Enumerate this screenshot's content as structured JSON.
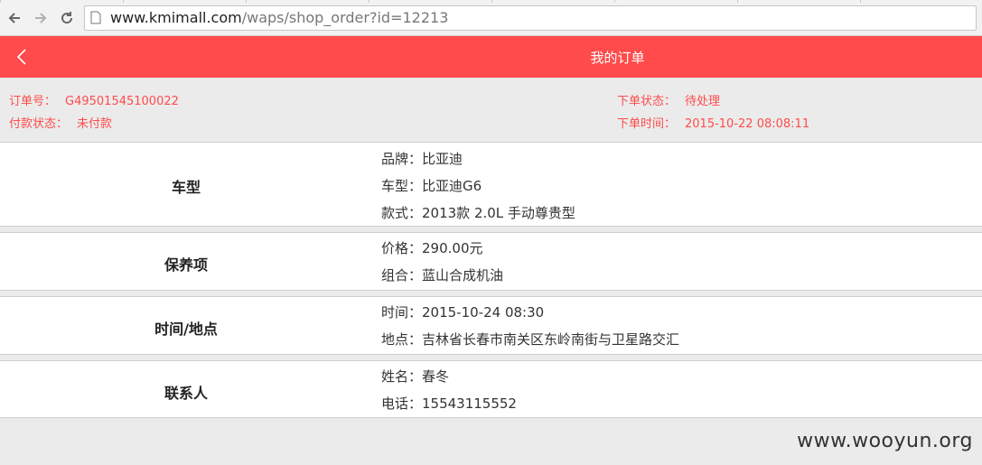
{
  "browser": {
    "url_host": "www.kmimall.com",
    "url_path": "/waps/shop_order?id=12213"
  },
  "header": {
    "title": "我的订单"
  },
  "order": {
    "number_label": "订单号：",
    "number_value": "G49501545100022",
    "pay_status_label": "付款状态：",
    "pay_status_value": "未付款",
    "order_status_label": "下单状态：",
    "order_status_value": "待处理",
    "order_time_label": "下单时间：",
    "order_time_value": "2015-10-22 08:08:11"
  },
  "sections": [
    {
      "label": "车型",
      "lines": [
        "品牌：比亚迪",
        "车型：比亚迪G6",
        "款式：2013款 2.0L 手动尊贵型"
      ]
    },
    {
      "label": "保养项",
      "lines": [
        "价格：290.00元",
        "组合：蓝山合成机油"
      ]
    },
    {
      "label": "时间/地点",
      "lines": [
        "时间：2015-10-24 08:30",
        "地点：吉林省长春市南关区东岭南街与卫星路交汇"
      ]
    },
    {
      "label": "联系人",
      "lines": [
        "姓名：春冬",
        "电话：15543115552"
      ]
    }
  ],
  "watermark": "www.wooyun.org",
  "colors": {
    "accent": "#ff4b4b"
  },
  "icons": {
    "back": "chevron-left-icon",
    "page": "page-icon"
  }
}
